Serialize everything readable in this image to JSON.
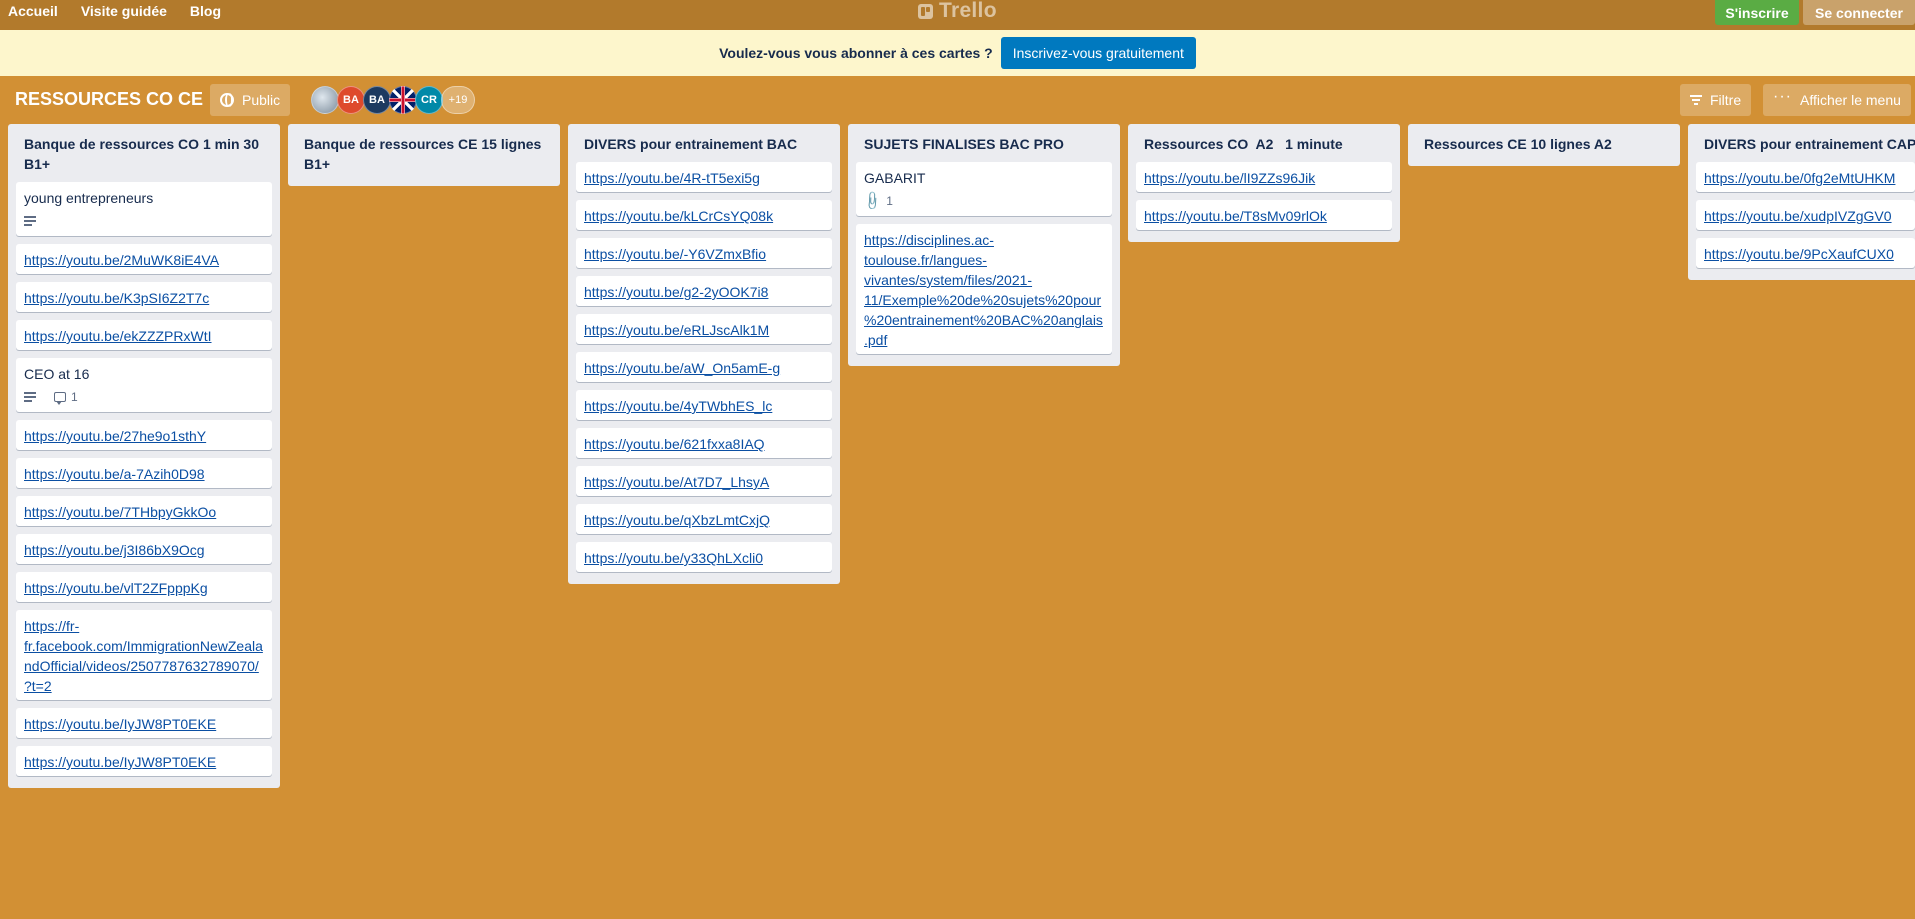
{
  "topbar": {
    "nav": [
      "Accueil",
      "Visite guidée",
      "Blog"
    ],
    "logo": "Trello",
    "signup_label": "S'inscrire",
    "login_label": "Se connecter"
  },
  "banner": {
    "text": "Voulez-vous vous abonner à ces cartes ?",
    "button_label": "Inscrivez-vous gratuitement"
  },
  "board": {
    "title": "RESSOURCES CO CE",
    "visibility_label": "Public",
    "members": [
      "BA",
      "BA",
      "CR"
    ],
    "more_members": "+19",
    "filter_label": "Filtre",
    "menu_label": "Afficher le menu"
  },
  "colors": {
    "board_bg": "#d29034",
    "topbar_bg": "#b27a2c",
    "banner_bg": "#fdf6cc",
    "signup_green": "#5aac44",
    "primary_blue": "#0079bf"
  },
  "lists": [
    {
      "title": "Banque de ressources CO 1 min 30 B1+",
      "cards": [
        {
          "text": "young entrepreneurs",
          "link": false,
          "desc": true
        },
        {
          "text": "https://youtu.be/2MuWK8iE4VA",
          "link": true
        },
        {
          "text": "https://youtu.be/K3pSI6Z2T7c",
          "link": true
        },
        {
          "text": "https://youtu.be/ekZZZPRxWtI",
          "link": true
        },
        {
          "text": "CEO at 16",
          "link": false,
          "desc": true,
          "comments": "1"
        },
        {
          "text": "https://youtu.be/27he9o1sthY",
          "link": true
        },
        {
          "text": "https://youtu.be/a-7Azih0D98",
          "link": true
        },
        {
          "text": "https://youtu.be/7THbpyGkkOo",
          "link": true
        },
        {
          "text": "https://youtu.be/j3I86bX9Ocg",
          "link": true
        },
        {
          "text": "https://youtu.be/vlT2ZFpppKg",
          "link": true
        },
        {
          "text": "https://fr-fr.facebook.com/ImmigrationNewZealandOfficial/videos/2507787632789070/?t=2",
          "link": true
        },
        {
          "text": "https://youtu.be/IyJW8PT0EKE",
          "link": true
        },
        {
          "text": "https://youtu.be/IyJW8PT0EKE",
          "link": true
        }
      ]
    },
    {
      "title": "Banque de ressources CE 15 lignes B1+",
      "cards": []
    },
    {
      "title": "DIVERS pour entrainement BAC",
      "cards": [
        {
          "text": "https://youtu.be/4R-tT5exi5g",
          "link": true
        },
        {
          "text": "https://youtu.be/kLCrCsYQ08k",
          "link": true
        },
        {
          "text": "https://youtu.be/-Y6VZmxBfio",
          "link": true
        },
        {
          "text": "https://youtu.be/g2-2yOOK7i8",
          "link": true
        },
        {
          "text": "https://youtu.be/eRLJscAlk1M",
          "link": true
        },
        {
          "text": "https://youtu.be/aW_On5amE-g",
          "link": true
        },
        {
          "text": "https://youtu.be/4yTWbhES_lc",
          "link": true
        },
        {
          "text": "https://youtu.be/621fxxa8IAQ",
          "link": true
        },
        {
          "text": "https://youtu.be/At7D7_LhsyA",
          "link": true
        },
        {
          "text": "https://youtu.be/qXbzLmtCxjQ",
          "link": true
        },
        {
          "text": "https://youtu.be/y33QhLXcli0",
          "link": true
        }
      ]
    },
    {
      "title": "SUJETS FINALISES BAC PRO",
      "cards": [
        {
          "text": "GABARIT",
          "link": false,
          "attachments": "1"
        },
        {
          "text": "https://disciplines.ac-toulouse.fr/langues-vivantes/system/files/2021-11/Exemple%20de%20sujets%20pour%20entrainement%20BAC%20anglais.pdf",
          "link": true
        }
      ]
    },
    {
      "title": "Ressources CO  A2   1 minute",
      "cards": [
        {
          "text": "https://youtu.be/lI9ZZs96Jik",
          "link": true
        },
        {
          "text": "https://youtu.be/T8sMv09rlOk",
          "link": true
        }
      ]
    },
    {
      "title": "Ressources CE 10 lignes A2",
      "cards": []
    },
    {
      "title": "DIVERS pour entrainement CAP",
      "cards": [
        {
          "text": "https://youtu.be/0fg2eMtUHKM",
          "link": true
        },
        {
          "text": "https://youtu.be/xudpIVZgGV0",
          "link": true
        },
        {
          "text": "https://youtu.be/9PcXaufCUX0",
          "link": true
        }
      ]
    }
  ]
}
